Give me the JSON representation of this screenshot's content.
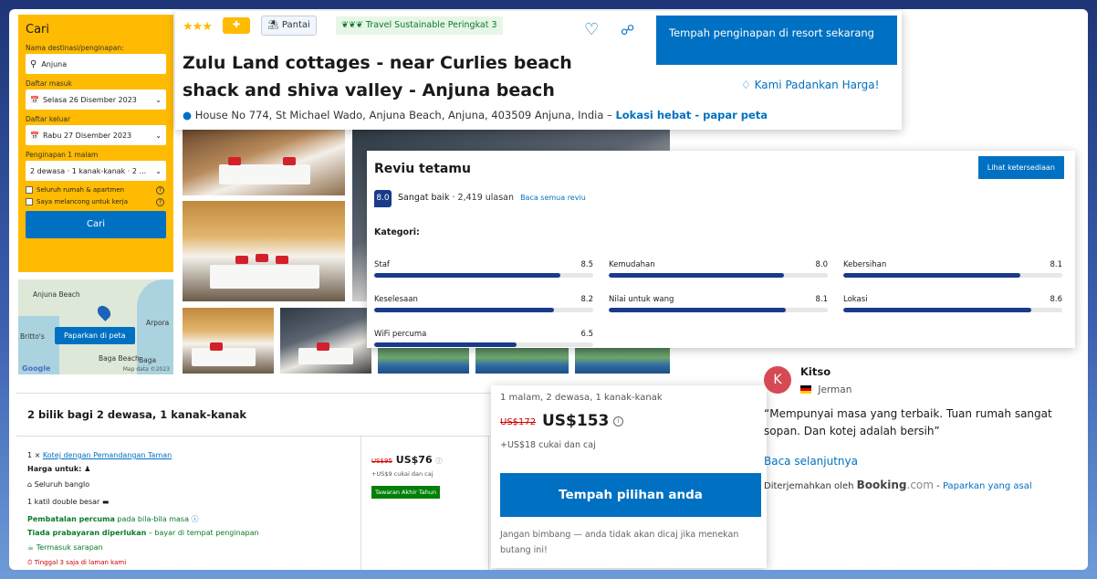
{
  "search": {
    "title": "Cari",
    "destination_label": "Nama destinasi/penginapan:",
    "destination_value": "Anjuna",
    "checkin_label": "Daftar masuk",
    "checkin_value": "Selasa 26 Disember 2023",
    "checkout_label": "Daftar keluar",
    "checkout_value": "Rabu 27 Disember 2023",
    "stay_label": "Penginapan 1 malam",
    "guests_value": "2 dewasa · 1 kanak-kanak · 2 ...",
    "option1": "Seluruh rumah & apartmen",
    "option2": "Saya melancong untuk kerja",
    "button": "Cari"
  },
  "map": {
    "label1": "Anjuna Beach",
    "label2": "Arpora",
    "label3": "Britto's",
    "label4": "Baga Beach",
    "label5": "Baga",
    "button": "Paparkan di peta",
    "brand": "Google",
    "attribution": "Map data ©2023"
  },
  "header": {
    "stars": "★★★",
    "thumbs": "👍+",
    "category": "Pantai",
    "sustainable": "Travel Sustainable Peringkat 3",
    "book_button": "Tempah penginapan di resort sekarang",
    "title": "Zulu Land cottages - near Curlies beach shack and shiva valley - Anjuna beach",
    "price_match": "Kami Padankan Harga!",
    "address": "House No 774, St Michael Wado, Anjuna Beach, Anjuna, 403509 Anjuna, India –",
    "location_link": "Lokasi hebat - papar peta"
  },
  "reviews": {
    "title": "Reviu tetamu",
    "availability_button": "Lihat ketersediaan",
    "score": "8.0",
    "score_label": "Sangat baik",
    "count": "· 2,419 ulasan",
    "read_all": "Baca semua reviu",
    "categories_title": "Kategori:",
    "categories": [
      {
        "name": "Staf",
        "value": "8.5"
      },
      {
        "name": "Kemudahan",
        "value": "8.0"
      },
      {
        "name": "Kebersihan",
        "value": "8.1"
      },
      {
        "name": "Keselesaan",
        "value": "8.2"
      },
      {
        "name": "Nilai untuk wang",
        "value": "8.1"
      },
      {
        "name": "Lokasi",
        "value": "8.6"
      },
      {
        "name": "WiFi percuma",
        "value": "6.5"
      }
    ]
  },
  "rooms": {
    "title": "2 bilik bagi 2 dewasa, 1 kanak-kanak",
    "qty": "1 ×",
    "room_name": "Kotej dengan Pemandangan Taman",
    "price_for": "Harga untuk:",
    "type": "Seluruh banglo",
    "bed": "1 katil double besar",
    "cancel_bold": "Pembatalan percuma",
    "cancel_rest": "pada bila-bila masa",
    "prepay_bold": "Tiada prabayaran diperlukan",
    "prepay_rest": "– bayar di tempat penginapan",
    "breakfast": "Termasuk sarapan",
    "scarcity": "Tinggal 3 saja di laman kami",
    "old_price": "US$95",
    "price": "US$76",
    "tax": "+US$9 cukai dan caj",
    "deal": "Tawaran Akhir Tahun"
  },
  "summary": {
    "occupancy": "1 malam, 2 dewasa, 1 kanak-kanak",
    "old_price": "US$172",
    "price": "US$153",
    "tax": "+US$18 cukai dan caj",
    "button": "Tempah pilihan anda",
    "note": "Jangan bimbang — anda tidak akan dicaj jika menekan butang ini!"
  },
  "testimonial": {
    "initial": "K",
    "name": "Kitso",
    "country": "Jerman",
    "quote": "“Mempunyai masa yang terbaik. Tuan rumah sangat sopan. Dan kotej adalah bersih”",
    "read_more": "Baca selanjutnya",
    "translated_by": "Diterjemahkan oleh",
    "brand_main": "Booking",
    "brand_suffix": ".com",
    "show_original": "Paparkan yang asal"
  },
  "colors": {
    "brand_blue": "#0071c2",
    "search_yellow": "#febb02",
    "score_navy": "#1a3a8a",
    "deal_green": "#008009"
  }
}
